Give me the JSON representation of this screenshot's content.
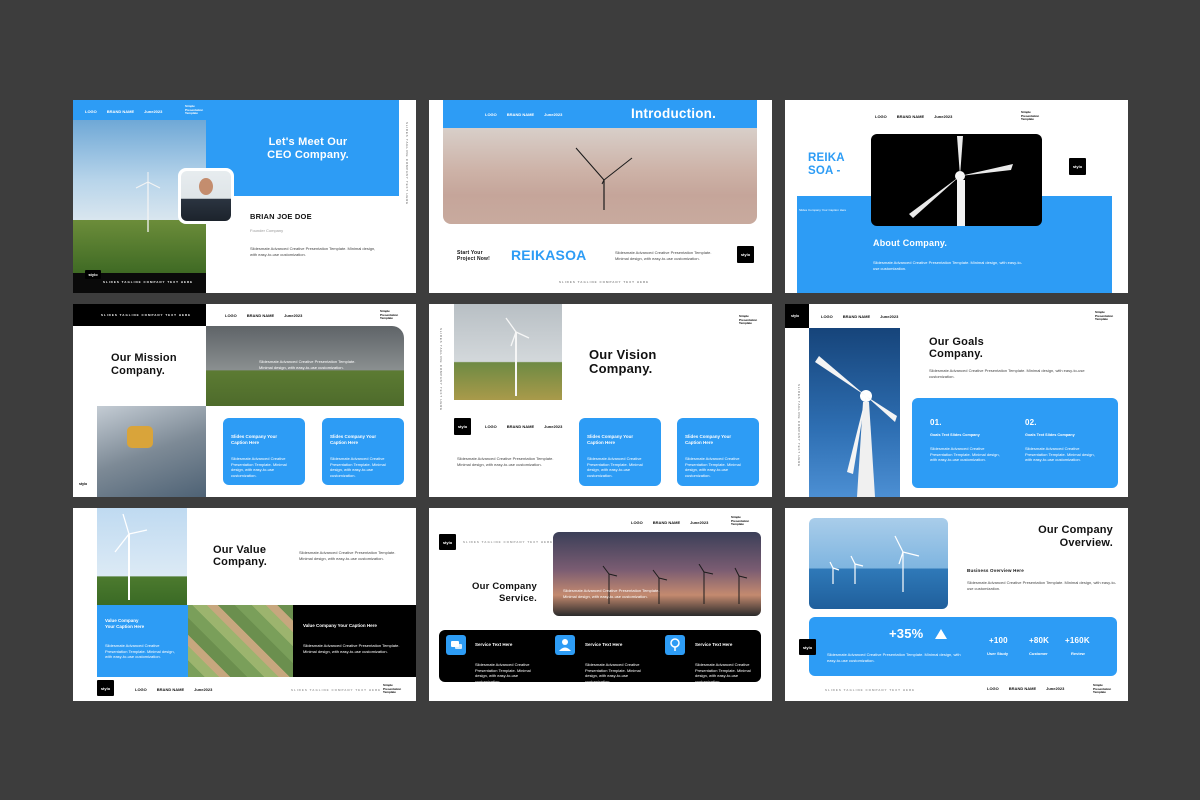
{
  "common": {
    "nav_logo": "LOGO",
    "nav_brand": "BRAND NAME",
    "nav_date": "June2023",
    "nav_title": "Simple Presentation Template",
    "logo_mark": "stylo",
    "tagline": "SLIDES TAGLINE COMPANY TEXT HERE",
    "body_text": "Slidesmate Advanced Creative Presentation Template. Minimal design, with easy-to-use customization.",
    "caption": "Slides Company Your Caption Here"
  },
  "slide1": {
    "title_line1": "Let's Meet Our",
    "title_line2": "CEO Company.",
    "person_name": "BRIAN JOE DOE",
    "person_role": "Founder Company"
  },
  "slide2": {
    "title": "Introduction.",
    "start_line1": "Start Your",
    "start_line2": "Project Now!",
    "brand_big": "REIKASOA"
  },
  "slide3": {
    "side_line1": "REIKA",
    "side_line2": "SOA -",
    "about": "About Company."
  },
  "slide4": {
    "title_line1": "Our Mission",
    "title_line2": "Company.",
    "card1_title": "Slides Company Your Caption Here",
    "card2_title": "Slides Company Your Caption Here"
  },
  "slide5": {
    "title_line1": "Our Vision",
    "title_line2": "Company.",
    "card1_title": "Slides Company Your Caption Here",
    "card2_title": "Slides Company Your Caption Here"
  },
  "slide6": {
    "title_line1": "Our Goals",
    "title_line2": "Company.",
    "num1": "01.",
    "num2": "02.",
    "goal1_title": "Goals Text Slides Company",
    "goal2_title": "Goals Text Slides Company"
  },
  "slide7": {
    "title_line1": "Our Value",
    "title_line2": "Company.",
    "blue_caption_line1": "Value Company",
    "blue_caption_line2": "Your Caption Here",
    "black_caption": "Value Company Your Caption Here"
  },
  "slide8": {
    "title_line1": "Our Company",
    "title_line2": "Service.",
    "service1": "Service Text Here",
    "service2": "Service Text Here",
    "service3": "Service Text Here"
  },
  "slide9": {
    "title_line1": "Our Company",
    "title_line2": "Overview.",
    "business": "Business Overview Here",
    "big_stat": "+35%",
    "stat1_value": "+100",
    "stat1_label": "User Study",
    "stat2_value": "+80K",
    "stat2_label": "Customer",
    "stat3_value": "+160K",
    "stat3_label": "Review"
  },
  "colors": {
    "accent": "#2d9cf5",
    "background": "#3d3d3d",
    "black": "#000000",
    "white": "#ffffff"
  }
}
